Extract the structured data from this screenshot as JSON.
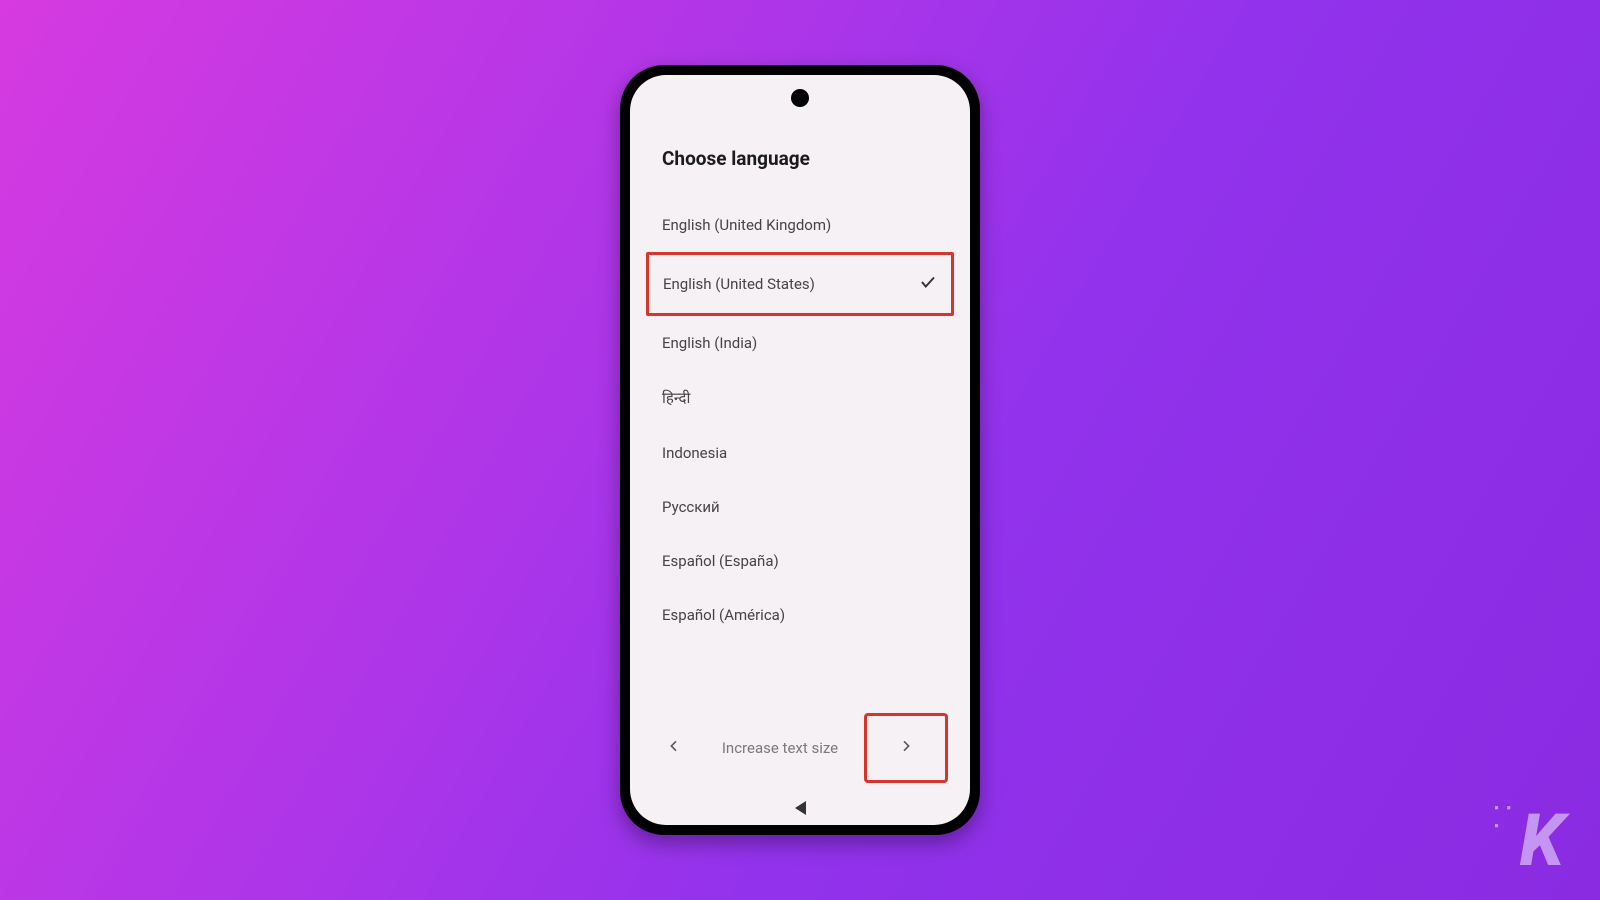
{
  "title": "Choose language",
  "languages": [
    {
      "label": "English (United Kingdom)",
      "selected": false
    },
    {
      "label": "English (United States)",
      "selected": true
    },
    {
      "label": "English (India)",
      "selected": false
    },
    {
      "label": "हिन्दी",
      "selected": false
    },
    {
      "label": "Indonesia",
      "selected": false
    },
    {
      "label": "Русский",
      "selected": false
    },
    {
      "label": "Español (España)",
      "selected": false
    },
    {
      "label": "Español (América)",
      "selected": false
    }
  ],
  "bottomBar": {
    "label": "Increase text size"
  },
  "watermark": "K",
  "highlightColor": "#d6352a"
}
